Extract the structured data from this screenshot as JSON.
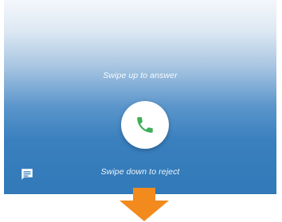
{
  "incoming_call": {
    "answer_hint": "Swipe up to answer",
    "reject_hint": "Swipe down to reject"
  },
  "icons": {
    "answer": "phone-icon",
    "message": "message-icon",
    "up": "arrow-up-icon",
    "down": "arrow-down-icon"
  },
  "colors": {
    "answer_phone": "#3fae5a",
    "arrow": "#f28a1e",
    "background_top": "#f4f7fb",
    "background_bottom": "#3179b8"
  }
}
